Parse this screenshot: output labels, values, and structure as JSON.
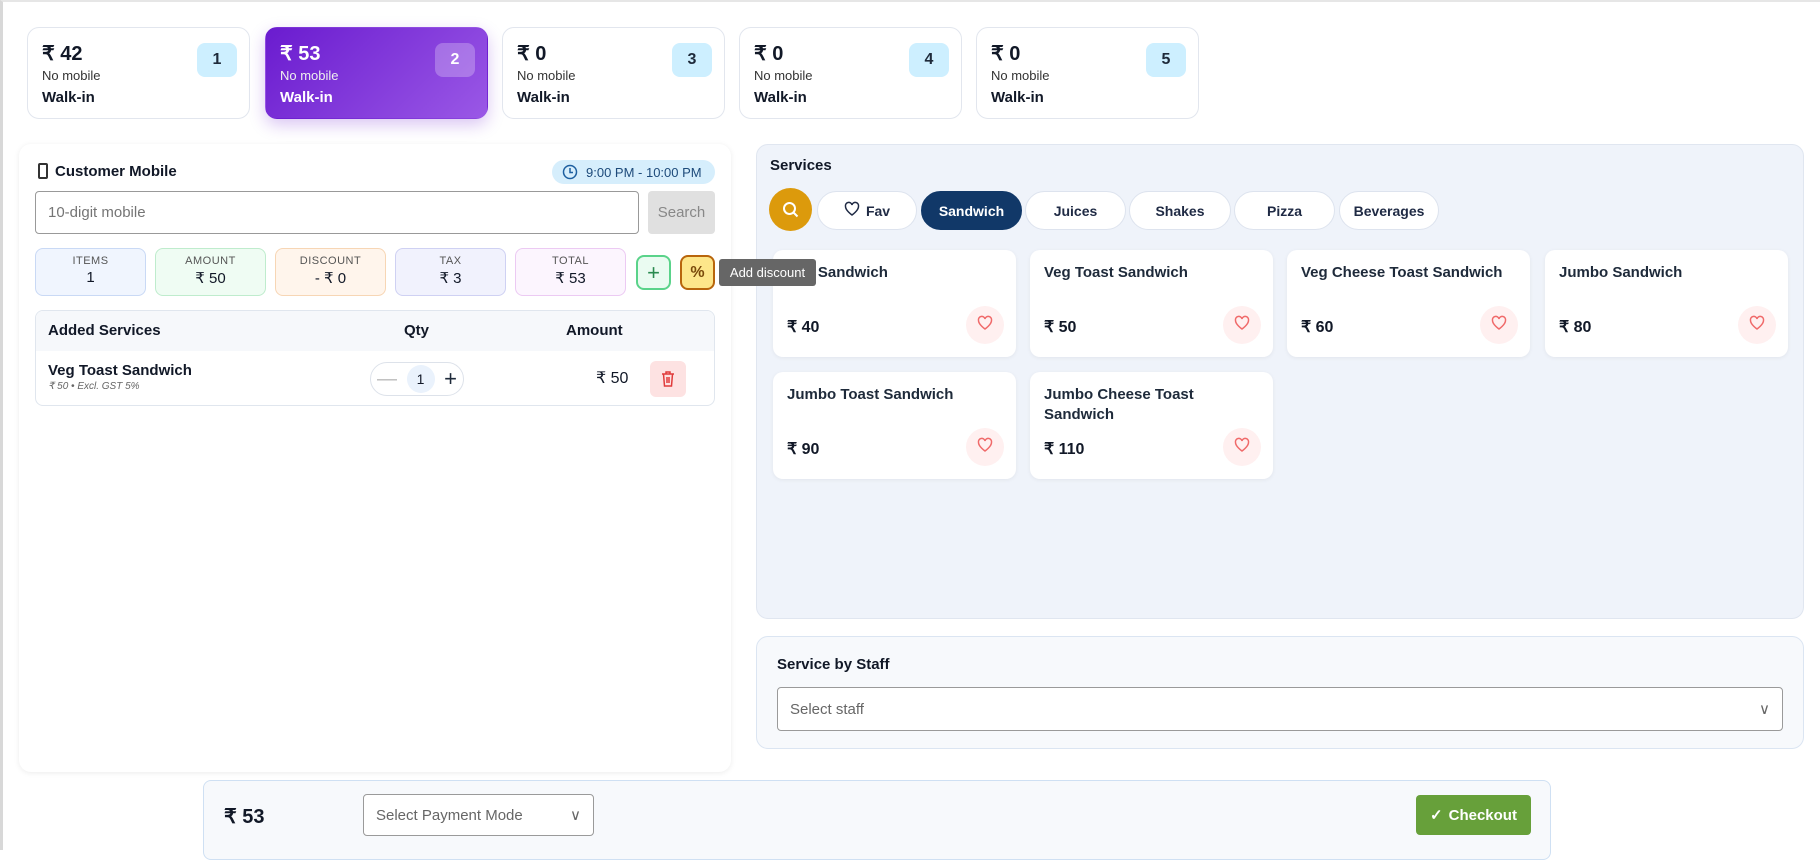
{
  "tickets": [
    {
      "amount": "₹ 42",
      "mobile": "No mobile",
      "customer": "Walk-in",
      "number": "1",
      "active": false
    },
    {
      "amount": "₹ 53",
      "mobile": "No mobile",
      "customer": "Walk-in",
      "number": "2",
      "active": true
    },
    {
      "amount": "₹ 0",
      "mobile": "No mobile",
      "customer": "Walk-in",
      "number": "3",
      "active": false
    },
    {
      "amount": "₹ 0",
      "mobile": "No mobile",
      "customer": "Walk-in",
      "number": "4",
      "active": false
    },
    {
      "amount": "₹ 0",
      "mobile": "No mobile",
      "customer": "Walk-in",
      "number": "5",
      "active": false
    }
  ],
  "customer": {
    "title": "Customer Mobile",
    "time_slot": "9:00 PM - 10:00 PM",
    "mobile_placeholder": "10-digit mobile",
    "search_label": "Search"
  },
  "stats": [
    {
      "label": "ITEMS",
      "value": "1"
    },
    {
      "label": "AMOUNT",
      "value": "₹ 50"
    },
    {
      "label": "DISCOUNT",
      "value": "- ₹ 0"
    },
    {
      "label": "TAX",
      "value": "₹ 3"
    },
    {
      "label": "TOTAL",
      "value": "₹ 53"
    }
  ],
  "tooltip": "Add discount",
  "cart": {
    "headers": [
      "Added Services",
      "Qty",
      "Amount"
    ],
    "rows": [
      {
        "name": "Veg Toast Sandwich",
        "meta": "₹ 50 • Excl. GST 5%",
        "qty": "1",
        "amount": "₹ 50"
      }
    ]
  },
  "services": {
    "title": "Services",
    "categories": [
      "Fav",
      "Sandwich",
      "Juices",
      "Shakes",
      "Pizza",
      "Beverages"
    ],
    "active_category": "Sandwich",
    "items": [
      {
        "name": "Veg Sandwich",
        "price": "₹ 40"
      },
      {
        "name": "Veg Toast Sandwich",
        "price": "₹ 50"
      },
      {
        "name": "Veg Cheese Toast Sandwich",
        "price": "₹ 60"
      },
      {
        "name": "Jumbo Sandwich",
        "price": "₹ 80"
      },
      {
        "name": "Jumbo Toast Sandwich",
        "price": "₹ 90"
      },
      {
        "name": "Jumbo Cheese Toast Sandwich",
        "price": "₹ 110"
      }
    ]
  },
  "staff": {
    "title": "Service by Staff",
    "placeholder": "Select staff"
  },
  "footer": {
    "total": "₹ 53",
    "payment_placeholder": "Select Payment Mode",
    "checkout_label": "Checkout"
  },
  "colors": {
    "active_ticket": "#6a1bcf",
    "active_chip": "#113868",
    "checkout": "#67a03a",
    "search_circle": "#dc9a0c"
  }
}
